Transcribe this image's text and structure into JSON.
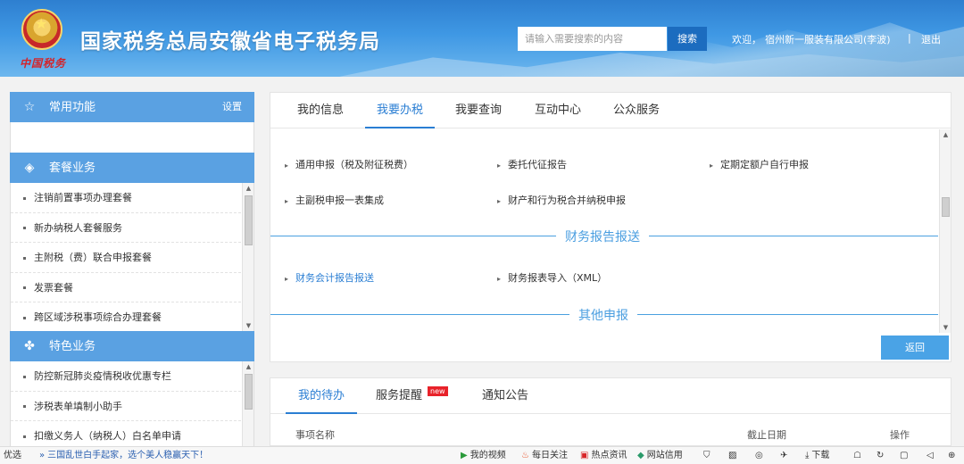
{
  "header": {
    "logo_text": "中国税务",
    "title": "国家税务总局安徽省电子税务局",
    "search_placeholder": "请输入需要搜索的内容",
    "search_button": "搜索",
    "welcome": "欢迎，",
    "company": "宿州新一服装有限公司(李波)",
    "separator": "|",
    "logout": "退出"
  },
  "sidebar": {
    "common": {
      "title": "常用功能",
      "action": "设置"
    },
    "package": {
      "title": "套餐业务",
      "items": [
        "注销前置事项办理套餐",
        "新办纳税人套餐服务",
        "主附税（费）联合申报套餐",
        "发票套餐",
        "跨区域涉税事项综合办理套餐"
      ]
    },
    "special": {
      "title": "特色业务",
      "items": [
        "防控新冠肺炎疫情税收优惠专栏",
        "涉税表单填制小助手",
        "扣缴义务人（纳税人）白名单申请"
      ]
    }
  },
  "main": {
    "tabs": [
      "我的信息",
      "我要办税",
      "我要查询",
      "互动中心",
      "公众服务"
    ],
    "active_tab": 1,
    "declare_items": [
      "通用申报（税及附征税费）",
      "委托代征报告",
      "定期定额户自行申报",
      "主副税申报一表集成",
      "财产和行为税合并纳税申报"
    ],
    "section_finance": "财务报告报送",
    "finance_items": [
      "财务会计报告报送",
      "财务报表导入（XML）"
    ],
    "section_other": "其他申报",
    "back_button": "返回"
  },
  "todo": {
    "tabs": [
      "我的待办",
      "服务提醒",
      "通知公告"
    ],
    "badge": "new",
    "columns": [
      "事项名称",
      "截止日期",
      "操作"
    ]
  },
  "statusbar": {
    "left": "优选",
    "ticker": "三国乱世白手起家，选个美人稳赢天下！",
    "items": [
      "我的视频",
      "每日关注",
      "热点资讯",
      "网站信用",
      "下载"
    ]
  },
  "colors": {
    "header_blue": "#3f98e4",
    "sidebar_blue": "#5aa1e2",
    "link_blue": "#2a7ed3",
    "badge_red": "#e8222a"
  }
}
